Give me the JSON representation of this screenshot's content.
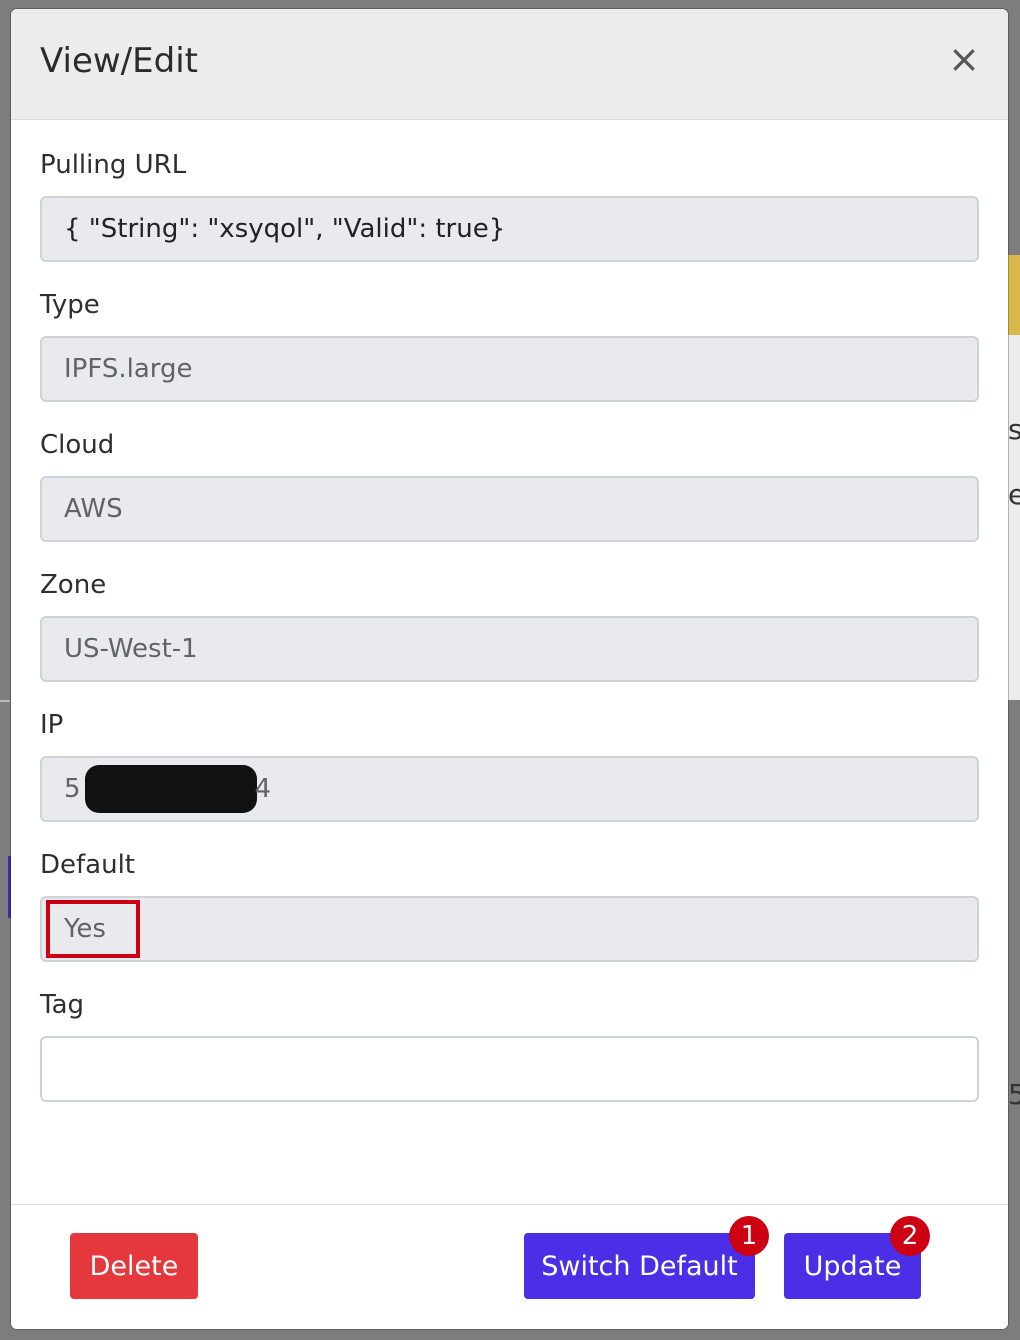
{
  "modal": {
    "title": "View/Edit",
    "close_glyph": "×"
  },
  "fields": {
    "pulling_url": {
      "label": "Pulling URL",
      "value": "{  \"String\": \"xsyqol\",  \"Valid\": true}"
    },
    "type": {
      "label": "Type",
      "value": "IPFS.large"
    },
    "cloud": {
      "label": "Cloud",
      "value": "AWS"
    },
    "zone": {
      "label": "Zone",
      "value": "US-West-1"
    },
    "ip": {
      "label": "IP",
      "value_start": "5",
      "value_end": "4"
    },
    "default": {
      "label": "Default",
      "value": "Yes"
    },
    "tag": {
      "label": "Tag",
      "value": ""
    }
  },
  "footer": {
    "delete_label": "Delete",
    "switch_default_label": "Switch Default",
    "update_label": "Update",
    "step_1": "1",
    "step_2": "2"
  },
  "background": {
    "glyph_1": "s",
    "glyph_2": "e",
    "glyph_3": "5"
  },
  "colors": {
    "primary": "#4b2fe6",
    "danger": "#e5383d",
    "annotation_red": "#cc0012"
  },
  "icons": {
    "close": "close-icon"
  }
}
